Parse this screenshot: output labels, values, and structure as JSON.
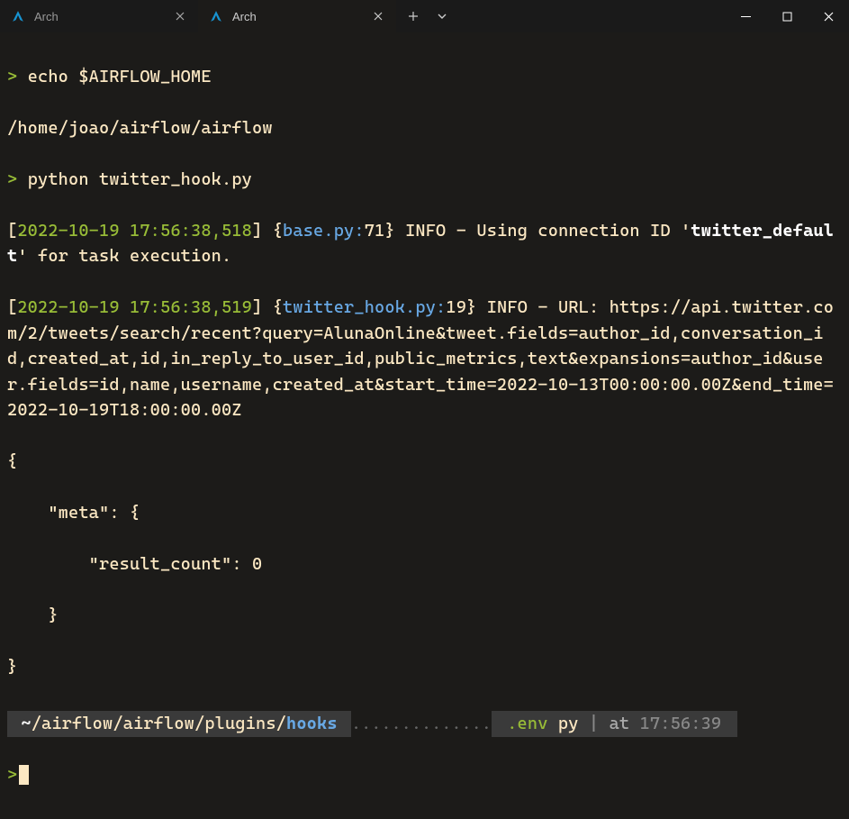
{
  "tabs": [
    {
      "title": "Arch",
      "active": false
    },
    {
      "title": "Arch",
      "active": true
    }
  ],
  "terminal": {
    "prompt_char": ">",
    "line1_cmd": "echo $AIRFLOW_HOME",
    "line2_out": "/home/joao/airflow/airflow",
    "line3_cmd": "python twitter_hook.py",
    "log1_ts": "2022-10-19 17:56:38,518",
    "log1_file": "base.py:",
    "log1_lineno": "71",
    "log1_level": "INFO",
    "log1_msg_a": " - Using connection ID '",
    "log1_msg_bold": "twitter_default",
    "log1_msg_b": "' for task execution.",
    "log2_ts": "2022-10-19 17:56:38,519",
    "log2_file": "twitter_hook.py:",
    "log2_lineno": "19",
    "log2_level": "INFO",
    "log2_msg": " - URL: https://api.twitter.com/2/tweets/search/recent?query=AlunaOnline&tweet.fields=author_id,conversation_id,created_at,id,in_reply_to_user_id,public_metrics,text&expansions=author_id&user.fields=id,name,username,created_at&start_time=2022-10-13T00:00:00.00Z&end_time=2022-10-19T18:00:00.00Z",
    "json_open": "{",
    "json_meta": "    \"meta\": {",
    "json_rc": "        \"result_count\": 0",
    "json_meta_close": "    }",
    "json_close": "}"
  },
  "status": {
    "path_tilde": " ~",
    "path_rest": "/airflow/airflow/plugins/",
    "path_last": "hooks ",
    "dots": "..............",
    "env": ".env",
    "py": "py",
    "pipe": " | ",
    "at": "at ",
    "time": "17:56:39 "
  }
}
